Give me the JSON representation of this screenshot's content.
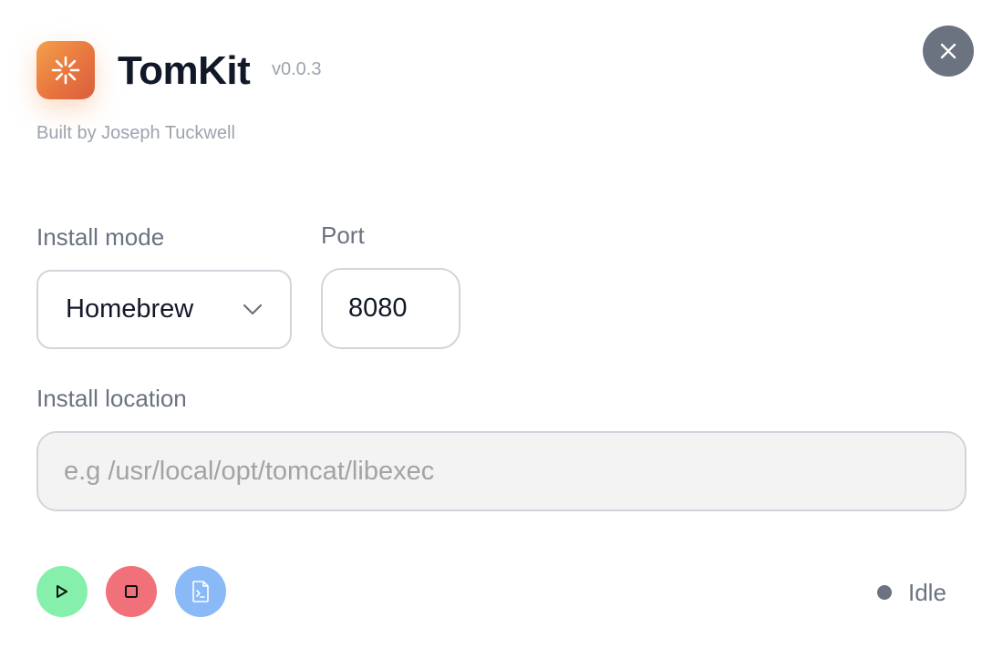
{
  "app": {
    "title": "TomKit",
    "version": "v0.0.3",
    "author": "Built by Joseph Tuckwell",
    "icon": "asterisk-spark-icon",
    "accent_colors": [
      "#f3a04a",
      "#d85e3d"
    ]
  },
  "header": {
    "close_icon": "close-icon"
  },
  "form": {
    "install_mode": {
      "label": "Install mode",
      "selected": "Homebrew",
      "icon": "chevron-down-icon"
    },
    "port": {
      "label": "Port",
      "value": "8080"
    },
    "install_location": {
      "label": "Install location",
      "value": "",
      "placeholder": "e.g /usr/local/opt/tomcat/libexec"
    }
  },
  "actions": {
    "start": {
      "icon": "play-icon",
      "color": "#86efac"
    },
    "stop": {
      "icon": "stop-icon",
      "color": "#f0717a"
    },
    "logs": {
      "icon": "terminal-file-icon",
      "color": "#8ab9f8"
    }
  },
  "status": {
    "text": "Idle",
    "color": "#6b7280"
  }
}
